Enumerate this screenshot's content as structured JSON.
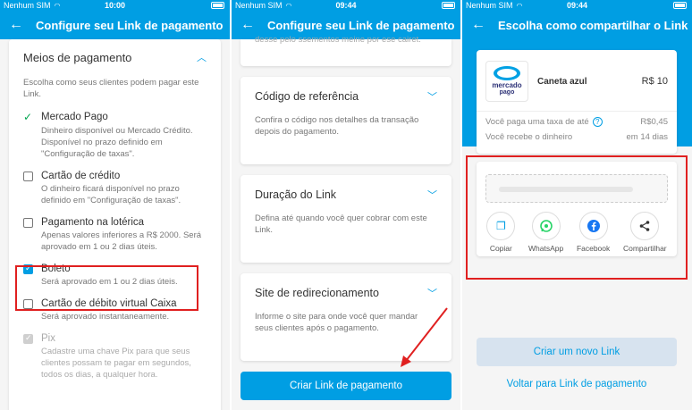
{
  "panel1": {
    "status": {
      "carrier": "Nenhum SIM",
      "time": "10:00"
    },
    "title": "Configure seu Link de pagamento",
    "section_title": "Meios de pagamento",
    "section_desc": "Escolha como seus clientes podem pagar este Link.",
    "options": [
      {
        "label": "Mercado Pago",
        "desc": "Dinheiro disponível ou Mercado Crédito. Disponível no prazo definido em \"Configuração de taxas\".",
        "state": "tick"
      },
      {
        "label": "Cartão de crédito",
        "desc": "O dinheiro ficará disponível no prazo definido em \"Configuração de taxas\".",
        "state": "unchecked"
      },
      {
        "label": "Pagamento na lotérica",
        "desc": "Apenas valores inferiores a R$ 2000. Será aprovado em 1 ou 2 dias úteis.",
        "state": "unchecked"
      },
      {
        "label": "Boleto",
        "desc": "Será aprovado em 1 ou 2 dias úteis.",
        "state": "checked"
      },
      {
        "label": "Cartão de débito virtual Caixa",
        "desc": "Será aprovado instantaneamente.",
        "state": "unchecked"
      },
      {
        "label": "Pix",
        "desc": "Cadastre uma chave Pix para que seus clientes possam te pagar em segundos, todos os dias, a qualquer hora.",
        "state": "disabled"
      }
    ]
  },
  "panel2": {
    "status": {
      "carrier": "Nenhum SIM",
      "time": "09:44"
    },
    "title": "Configure seu Link de pagamento",
    "cutoff_text": "desse pelo ssementos meine por ese cairet.",
    "sections": [
      {
        "title": "Código de referência",
        "desc": "Confira o código nos detalhes da transação depois do pagamento."
      },
      {
        "title": "Duração do Link",
        "desc": "Defina até quando você quer cobrar com este Link."
      },
      {
        "title": "Site de redirecionamento",
        "desc": "Informe o site para onde você quer mandar seus clientes após o pagamento."
      }
    ],
    "button": "Criar Link de pagamento"
  },
  "panel3": {
    "status": {
      "carrier": "Nenhum SIM",
      "time": "09:44"
    },
    "title": "Escolha como compartilhar o Link",
    "logo_line1": "mercado",
    "logo_line2": "pago",
    "product": {
      "name": "Caneta azul",
      "price": "R$ 10"
    },
    "fee": {
      "label": "Você paga uma taxa de até",
      "value": "R$0,45"
    },
    "receive": {
      "label": "Você recebe o dinheiro",
      "value": "em 14 dias"
    },
    "share": [
      {
        "label": "Copiar",
        "icon": "copy-icon"
      },
      {
        "label": "WhatsApp",
        "icon": "whatsapp-icon"
      },
      {
        "label": "Facebook",
        "icon": "facebook-icon"
      },
      {
        "label": "Compartilhar",
        "icon": "share-icon"
      }
    ],
    "new_link_button": "Criar um novo Link",
    "back_link": "Voltar para Link de pagamento"
  },
  "colors": {
    "brand": "#009ee3",
    "highlight": "#e02020",
    "success": "#00a650"
  }
}
